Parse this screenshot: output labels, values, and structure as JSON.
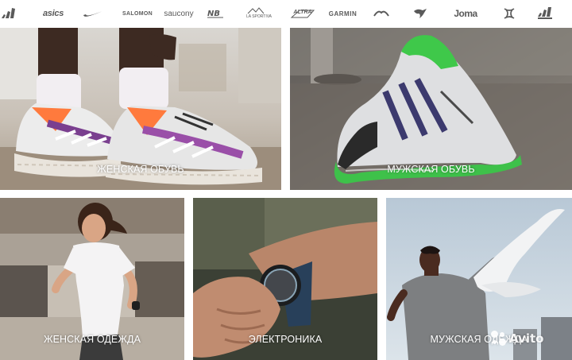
{
  "brands": [
    {
      "id": "adidas",
      "text": ""
    },
    {
      "id": "asics",
      "text": "asics"
    },
    {
      "id": "nike",
      "text": ""
    },
    {
      "id": "salomon",
      "text": "SALOMON"
    },
    {
      "id": "saucony",
      "text": "saucony"
    },
    {
      "id": "new-balance",
      "text": ""
    },
    {
      "id": "la-sportiva",
      "text": "LA SPORTIVA"
    },
    {
      "id": "altra",
      "text": "ALTRA"
    },
    {
      "id": "garmin",
      "text": "GARMIN"
    },
    {
      "id": "mizuno",
      "text": ""
    },
    {
      "id": "puma",
      "text": ""
    },
    {
      "id": "joma",
      "text": "Joma"
    },
    {
      "id": "under-armour",
      "text": ""
    },
    {
      "id": "adidas",
      "text": ""
    }
  ],
  "categories": {
    "womens_shoes": "ЖЕНСКАЯ ОБУВЬ",
    "mens_shoes": "МУЖСКАЯ ОБУВЬ",
    "womens_clothing": "ЖЕНСКАЯ ОДЕЖДА",
    "electronics": "ЭЛЕКТРОНИКА",
    "mens_clothing": "МУЖСКАЯ ОДЕЖДА"
  },
  "watermark": {
    "text": "Avito"
  },
  "colors": {
    "label_text": "#ffffff",
    "brand_logo": "#5a5a5a",
    "accent_green": "#3ec14a"
  }
}
